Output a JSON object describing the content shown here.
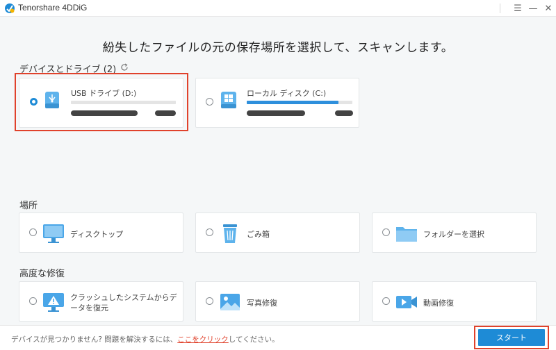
{
  "window": {
    "title": "Tenorshare 4DDiG",
    "controls": {
      "menu": "☰",
      "minimize": "—",
      "close": "✕"
    }
  },
  "headline": "紛失したファイルの元の保存場所を選択して、スキャンします。",
  "devices": {
    "label": "デバイスとドライブ (2)",
    "items": [
      {
        "name": "USB ドライブ (D:)",
        "icon": "usb-drive-icon",
        "selected": true,
        "usage": 0.0
      },
      {
        "name": "ローカル ディスク (C:)",
        "icon": "windows-disk-icon",
        "selected": false,
        "usage": 0.87
      }
    ]
  },
  "location": {
    "label": "場所",
    "items": [
      {
        "name": "ディスクトップ",
        "icon": "desktop-icon"
      },
      {
        "name": "ごみ箱",
        "icon": "trash-icon"
      },
      {
        "name": "フォルダーを選択",
        "icon": "folder-icon"
      }
    ]
  },
  "repair": {
    "label": "高度な修復",
    "items": [
      {
        "name": "クラッシュしたシステムからデータを復元",
        "icon": "crashed-system-icon"
      },
      {
        "name": "写真修復",
        "icon": "photo-icon"
      },
      {
        "name": "動画修復",
        "icon": "video-icon"
      }
    ]
  },
  "footer": {
    "prefix": "デバイスが見つかりません? 問題を解決するには、",
    "link": "ここをクリック",
    "suffix": "してください。",
    "start_label": "スタート"
  },
  "colors": {
    "accent": "#1e8bd6",
    "highlight": "#e0422c"
  }
}
